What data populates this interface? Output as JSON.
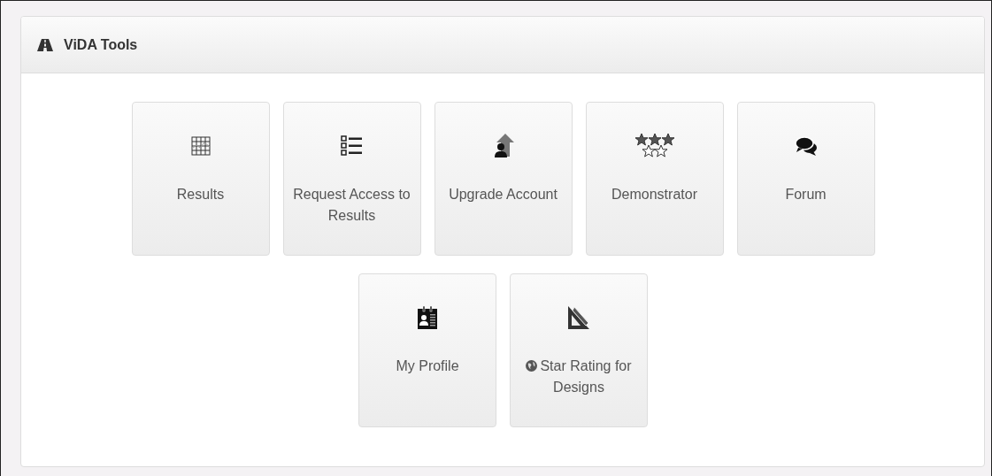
{
  "panel": {
    "title": "ViDA Tools"
  },
  "tiles": [
    {
      "label": "Results",
      "kind": "grid"
    },
    {
      "label": "Request Access to Results",
      "kind": "checklist"
    },
    {
      "label": "Upgrade Account",
      "kind": "upgrade"
    },
    {
      "label": "Demonstrator",
      "kind": "stars"
    },
    {
      "label": "Forum",
      "kind": "chat"
    },
    {
      "label": "My Profile",
      "kind": "idcard"
    },
    {
      "label": "Star Rating for Designs",
      "kind": "setsquare"
    }
  ]
}
